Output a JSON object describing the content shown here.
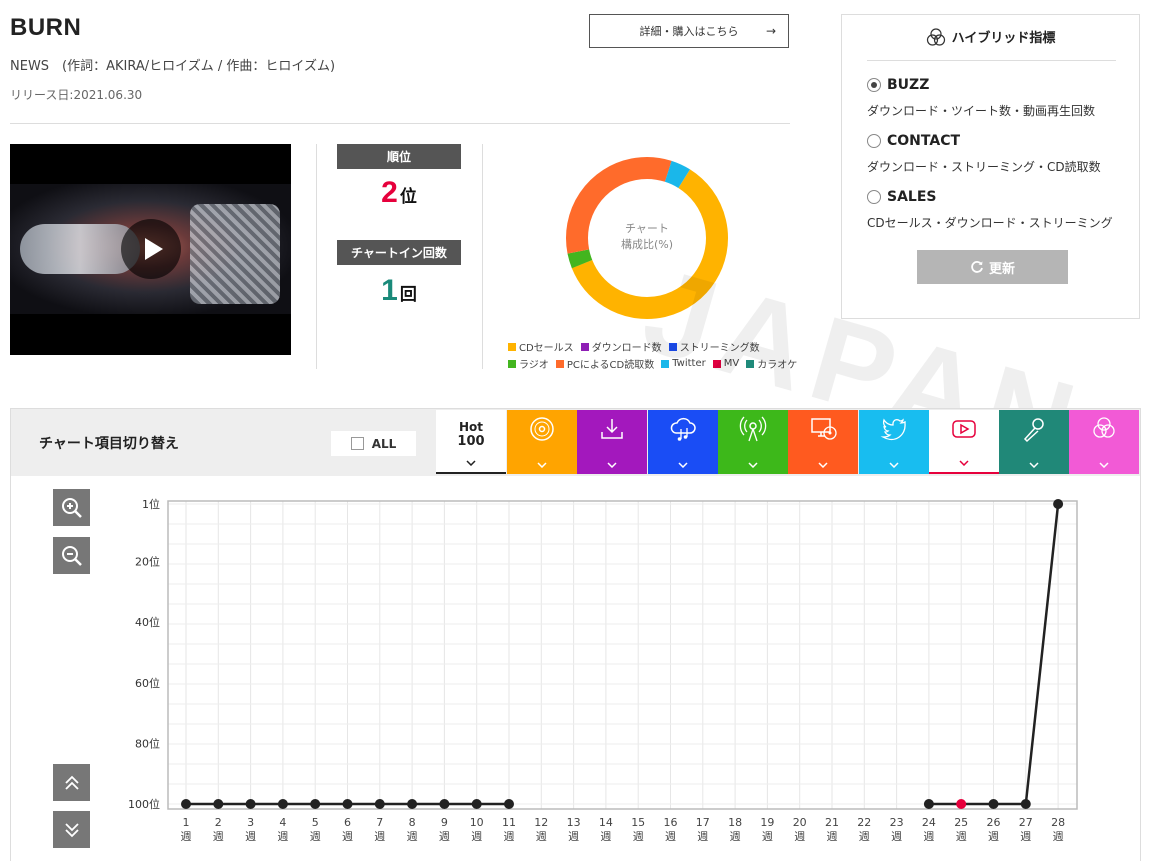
{
  "song": {
    "title": "BURN",
    "credits": "NEWS　(作詞：AKIRA/ヒロイズム / 作曲：ヒロイズム)",
    "release": "リリース日:2021.06.30",
    "detail_button": "詳細・購入はこちら",
    "detail_arrow": "→"
  },
  "stats": {
    "rank_label": "順位",
    "rank_value": "2",
    "rank_unit": "位",
    "chartin_label": "チャートイン回数",
    "chartin_value": "1",
    "chartin_unit": "回",
    "rank_color": "#e6003c",
    "chartin_color": "#1a8a7a"
  },
  "donut": {
    "center_line1": "チャート",
    "center_line2": "構成比(%)",
    "segments": [
      {
        "name": "CDセールス",
        "value": 60,
        "color": "#ffb300"
      },
      {
        "name": "ラジオ",
        "value": 3,
        "color": "#43b51f"
      },
      {
        "name": "PCによるCD読取数",
        "value": 33,
        "color": "#ff6b2b"
      },
      {
        "name": "Twitter",
        "value": 4,
        "color": "#1ab7ea"
      }
    ]
  },
  "legend": {
    "row1": [
      {
        "label": "CDセールス",
        "color": "#ffb300"
      },
      {
        "label": "ダウンロード数",
        "color": "#8e1fb5"
      },
      {
        "label": "ストリーミング数",
        "color": "#1c4df0"
      }
    ],
    "row2": [
      {
        "label": "ラジオ",
        "color": "#43b51f"
      },
      {
        "label": "PCによるCD読取数",
        "color": "#ff6b2b"
      },
      {
        "label": "Twitter",
        "color": "#1ab7ea"
      },
      {
        "label": "MV",
        "color": "#e00040"
      },
      {
        "label": "カラオケ",
        "color": "#1f8a7a"
      }
    ]
  },
  "hybrid": {
    "title": "ハイブリッド指標",
    "options": [
      {
        "label": "BUZZ",
        "desc": "ダウンロード・ツイート数・動画再生回数",
        "selected": true
      },
      {
        "label": "CONTACT",
        "desc": "ダウンロード・ストリーミング・CD読取数",
        "selected": false
      },
      {
        "label": "SALES",
        "desc": "CDセールス・ダウンロード・ストリーミング",
        "selected": false
      }
    ],
    "refresh_label": "更新"
  },
  "watermark": "JAPAN",
  "switcher": {
    "title": "チャート項目切り替え",
    "all_label": "ALL",
    "hot_line1": "Hot",
    "hot_line2": "100",
    "tabs": [
      {
        "icon": "cd-icon",
        "color": "#ffa400"
      },
      {
        "icon": "download-icon",
        "color": "#a318bd"
      },
      {
        "icon": "streaming-icon",
        "color": "#1a4df5"
      },
      {
        "icon": "radio-icon",
        "color": "#3db81a"
      },
      {
        "icon": "pc-cd-icon",
        "color": "#ff5a1f"
      },
      {
        "icon": "twitter-icon",
        "color": "#18bdf0"
      },
      {
        "icon": "youtube-icon",
        "color": "#ffffff"
      },
      {
        "icon": "karaoke-icon",
        "color": "#208878"
      },
      {
        "icon": "hybrid-icon",
        "color": "#f25ad6"
      }
    ]
  },
  "chart_data": {
    "type": "line",
    "y_ticks": [
      "1位",
      "20位",
      "40位",
      "60位",
      "80位",
      "100位"
    ],
    "y_values": [
      1,
      20,
      40,
      60,
      80,
      100
    ],
    "ylim": [
      1,
      100
    ],
    "y_inverted": true,
    "x_labels": [
      "1",
      "2",
      "3",
      "4",
      "5",
      "6",
      "7",
      "8",
      "9",
      "10",
      "11",
      "12",
      "13",
      "14",
      "15",
      "16",
      "17",
      "18",
      "19",
      "20",
      "21",
      "22",
      "23",
      "24",
      "25",
      "26",
      "27",
      "28"
    ],
    "x_unit": "週",
    "segments": [
      {
        "x": [
          1,
          2,
          3,
          4,
          5,
          6,
          7,
          8,
          9,
          10,
          11
        ],
        "y": [
          100,
          100,
          100,
          100,
          100,
          100,
          100,
          100,
          100,
          100,
          100
        ]
      },
      {
        "x": [
          24,
          25,
          26,
          27,
          28
        ],
        "y": [
          100,
          100,
          100,
          100,
          1
        ]
      }
    ],
    "highlight_x": 25,
    "point_color": "#222222",
    "highlight_color": "#e6003c",
    "grid": true
  }
}
